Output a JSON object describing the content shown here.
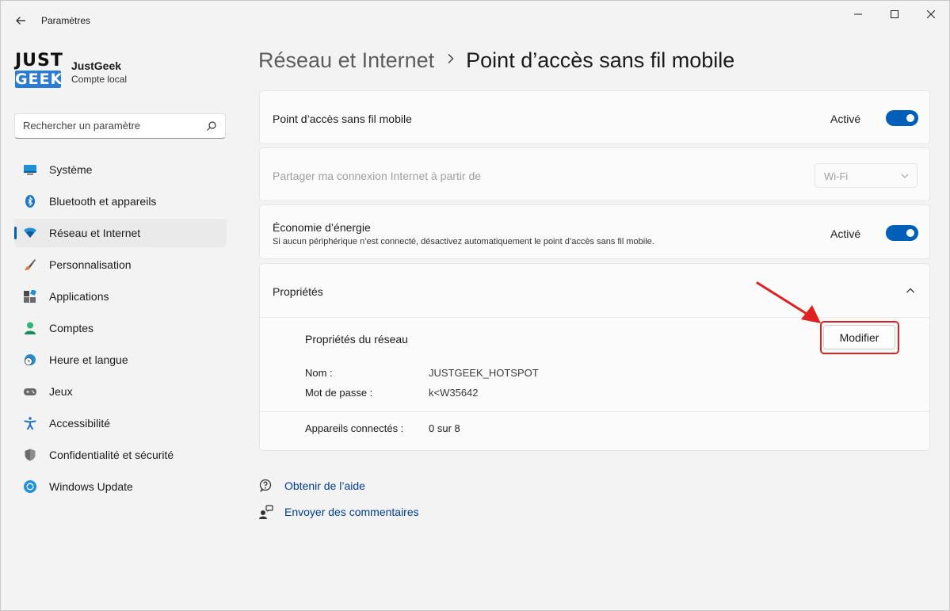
{
  "window": {
    "title": "Paramètres"
  },
  "profile": {
    "logo_top": "JUST",
    "logo_bottom": "GEEK",
    "name": "JustGeek",
    "account_type": "Compte local"
  },
  "search": {
    "placeholder": "Rechercher un paramètre"
  },
  "sidebar": {
    "items": [
      {
        "label": "Système",
        "icon": "monitor-icon"
      },
      {
        "label": "Bluetooth et appareils",
        "icon": "bluetooth-icon"
      },
      {
        "label": "Réseau et Internet",
        "icon": "wifi-icon",
        "active": true
      },
      {
        "label": "Personnalisation",
        "icon": "brush-icon"
      },
      {
        "label": "Applications",
        "icon": "apps-icon"
      },
      {
        "label": "Comptes",
        "icon": "person-icon"
      },
      {
        "label": "Heure et langue",
        "icon": "globe-clock-icon"
      },
      {
        "label": "Jeux",
        "icon": "gamepad-icon"
      },
      {
        "label": "Accessibilité",
        "icon": "accessibility-icon"
      },
      {
        "label": "Confidentialité et sécurité",
        "icon": "shield-icon"
      },
      {
        "label": "Windows Update",
        "icon": "update-icon"
      }
    ]
  },
  "header": {
    "parent": "Réseau et Internet",
    "current": "Point d’accès sans fil mobile"
  },
  "hotspot": {
    "title": "Point d’accès sans fil mobile",
    "state": "Activé",
    "on": true
  },
  "share": {
    "title": "Partager ma connexion Internet à partir de",
    "value": "Wi-Fi"
  },
  "power_saving": {
    "title": "Économie d’énergie",
    "description": "Si aucun périphérique n’est connecté, désactivez automatiquement le point d’accès sans fil mobile.",
    "state": "Activé",
    "on": true
  },
  "properties": {
    "title": "Propriétés",
    "network_props_label": "Propriétés du réseau",
    "modify_label": "Modifier",
    "name_label": "Nom :",
    "name_value": "JUSTGEEK_HOTSPOT",
    "password_label": "Mot de passe :",
    "password_value": "k<W35642",
    "connected_label": "Appareils connectés :",
    "connected_value": "0 sur 8"
  },
  "links": {
    "help": "Obtenir de l’aide",
    "feedback": "Envoyer des commentaires"
  },
  "colors": {
    "accent": "#005fb8",
    "highlight": "#e02020"
  }
}
